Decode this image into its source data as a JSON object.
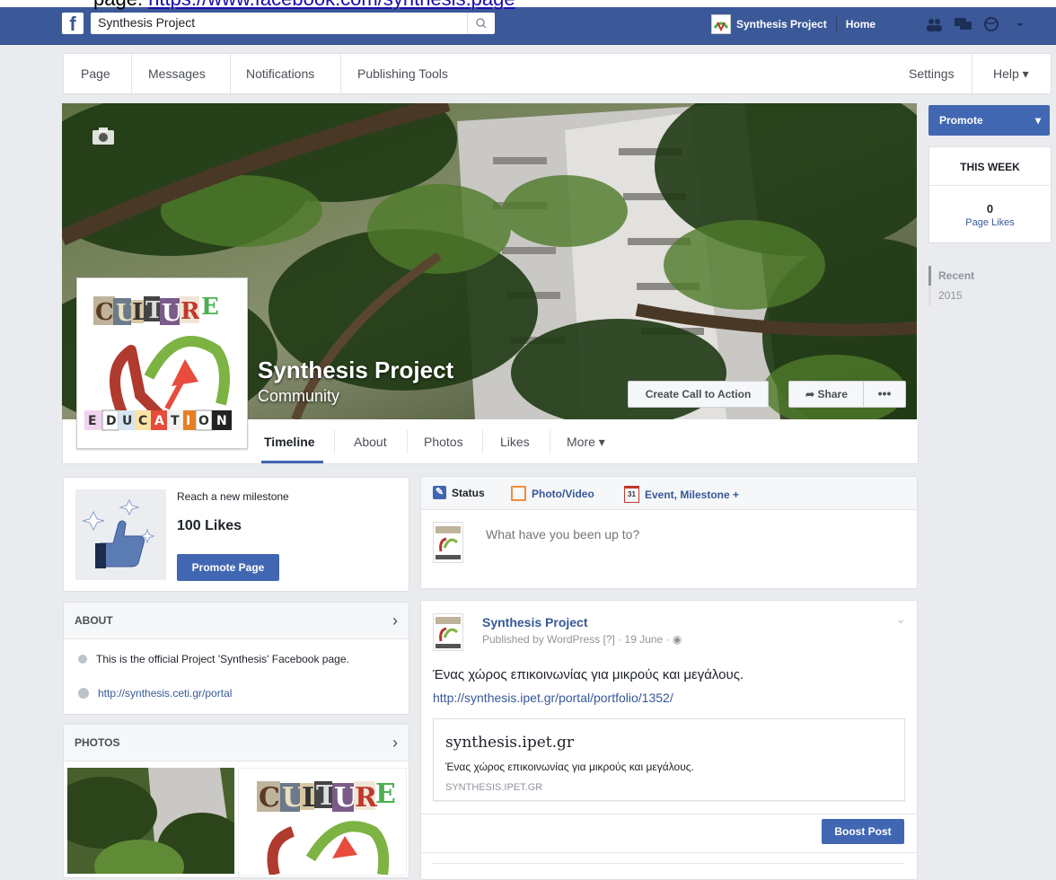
{
  "caption": {
    "prefix": "page:",
    "link": "https://www.facebook.com/synthesis.page"
  },
  "topbar": {
    "logo": "f",
    "search_value": "Synthesis Project",
    "page_name": "Synthesis Project",
    "home": "Home"
  },
  "pagenav": {
    "items": [
      "Page",
      "Messages",
      "Notifications",
      "Publishing Tools"
    ],
    "settings": "Settings",
    "help": "Help ▾"
  },
  "cover": {
    "title": "Synthesis Project",
    "subtitle": "Community",
    "cta": "Create Call to Action",
    "share": "Share",
    "more": "•••"
  },
  "profile": {
    "word_top": "CULTURE",
    "word_bottom": [
      "E",
      "D",
      "U",
      "C",
      "A",
      "T",
      "I",
      "O",
      "N"
    ]
  },
  "tabs": [
    "Timeline",
    "About",
    "Photos",
    "Likes",
    "More ▾"
  ],
  "sidebar": {
    "promote": "Promote",
    "this_week": "THIS WEEK",
    "likes_count": "0",
    "likes_label": "Page Likes",
    "recent_label": "Recent",
    "recent_year": "2015"
  },
  "milestone": {
    "line1": "Reach a new milestone",
    "line2": "100 Likes",
    "button": "Promote Page"
  },
  "about": {
    "header": "ABOUT",
    "description": "This is the official Project 'Synthesis' Facebook page.",
    "website": "http://synthesis.ceti.gr/portal"
  },
  "photos": {
    "header": "PHOTOS"
  },
  "composer": {
    "status": "Status",
    "photo_video": "Photo/Video",
    "event": "Event, Milestone +",
    "placeholder": "What have you been up to?"
  },
  "post": {
    "author": "Synthesis Project",
    "meta": "Published by WordPress [?] · 19 June · ",
    "text": "Ένας χώρος επικοινωνίας για μικρούς και μεγάλους.",
    "link": "http://synthesis.ipet.gr/portal/portfolio/1352/",
    "preview_title": "synthesis.ipet.gr",
    "preview_desc": "Ένας χώρος επικοινωνίας για μικρούς και μεγάλους.",
    "preview_domain": "SYNTHESIS.IPET.GR",
    "boost": "Boost Post"
  },
  "colors": {
    "brand": "#3b5998",
    "button": "#4267b2",
    "link": "#365899"
  }
}
